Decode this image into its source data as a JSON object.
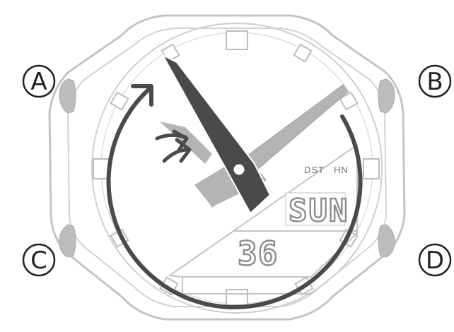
{
  "buttons": {
    "a": "A",
    "b": "B",
    "c": "C",
    "d": "D"
  },
  "lcd": {
    "indicator_dst": "DST",
    "indicator_hn": "HN",
    "day_of_week": "SUN",
    "day_number": "36"
  },
  "colors": {
    "case_outline": "#c4c4c4",
    "button_fill": "#bdbdbd",
    "hour_hand": "#b4b4b4",
    "minute_hand": "#4a4a4a",
    "arrow": "#4a4a4a"
  }
}
